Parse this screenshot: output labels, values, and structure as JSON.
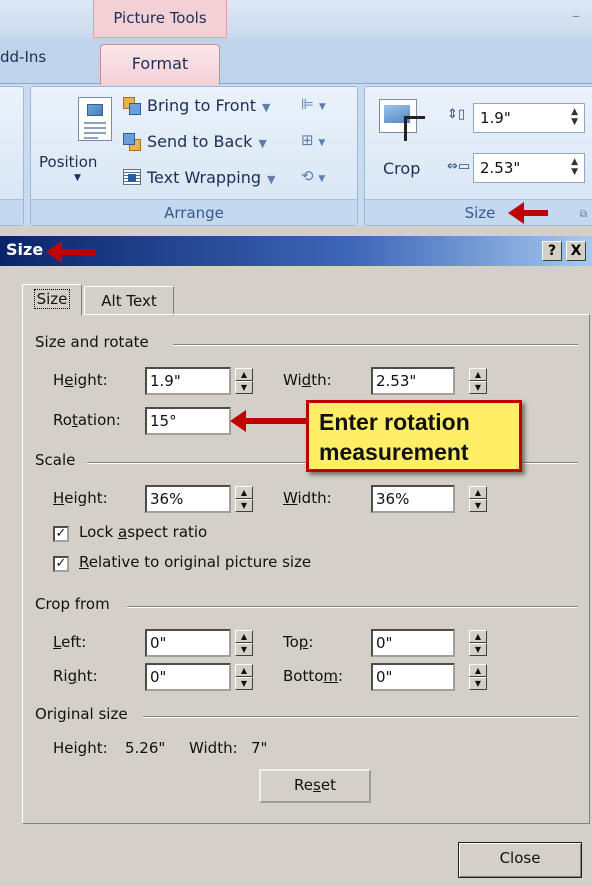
{
  "ribbon": {
    "context_header": "Picture Tools",
    "tabs": {
      "addins": "dd-Ins",
      "format": "Format"
    },
    "arrange": {
      "position_label": "Position",
      "bring_to_front": "Bring to Front",
      "send_to_back": "Send to Back",
      "text_wrapping": "Text Wrapping",
      "caption": "Arrange"
    },
    "size": {
      "crop_label": "Crop",
      "height_value": "1.9\"",
      "width_value": "2.53\"",
      "caption": "Size"
    }
  },
  "dialog": {
    "title": "Size",
    "help_button": "?",
    "close_x": "X",
    "tabs": [
      "Size",
      "Alt Text"
    ],
    "size_and_rotate": {
      "heading": "Size and rotate",
      "height_label": {
        "pre": "H",
        "u": "e",
        "post": "ight:"
      },
      "height_value": "1.9\"",
      "width_label": {
        "pre": "Wi",
        "u": "d",
        "post": "th:"
      },
      "width_value": "2.53\"",
      "rotation_label": {
        "pre": "Ro",
        "u": "t",
        "post": "ation:"
      },
      "rotation_value": "15°"
    },
    "scale": {
      "heading": "Scale",
      "height_label": {
        "pre": "",
        "u": "H",
        "post": "eight:"
      },
      "height_value": "36%",
      "width_label": {
        "pre": "",
        "u": "W",
        "post": "idth:"
      },
      "width_value": "36%",
      "lock_aspect": {
        "pre": "Lock ",
        "u": "a",
        "post": "spect ratio",
        "checked": true
      },
      "relative": {
        "pre": "",
        "u": "R",
        "post": "elative to original picture size",
        "checked": true
      }
    },
    "crop_from": {
      "heading": "Crop from",
      "left_label": {
        "pre": "",
        "u": "L",
        "post": "eft:"
      },
      "left_value": "0\"",
      "top_label": {
        "pre": "To",
        "u": "p",
        "post": ":"
      },
      "top_value": "0\"",
      "right_label": {
        "pre": "Ri",
        "u": "g",
        "post": "ht:"
      },
      "right_value": "0\"",
      "bottom_label": {
        "pre": "Botto",
        "u": "m",
        "post": ":"
      },
      "bottom_value": "0\""
    },
    "original_size": {
      "heading": "Original size",
      "height_label": "Height:",
      "height_value": "5.26\"",
      "width_label": "Width:",
      "width_value": "7\""
    },
    "reset_button": {
      "pre": "Re",
      "u": "s",
      "post": "et"
    },
    "close_button": "Close"
  },
  "callout": {
    "line1": "Enter rotation",
    "line2": "measurement"
  },
  "colors": {
    "annotation_red": "#c00000",
    "callout_yellow": "#ffee66",
    "title_blue": "#0a246a"
  }
}
